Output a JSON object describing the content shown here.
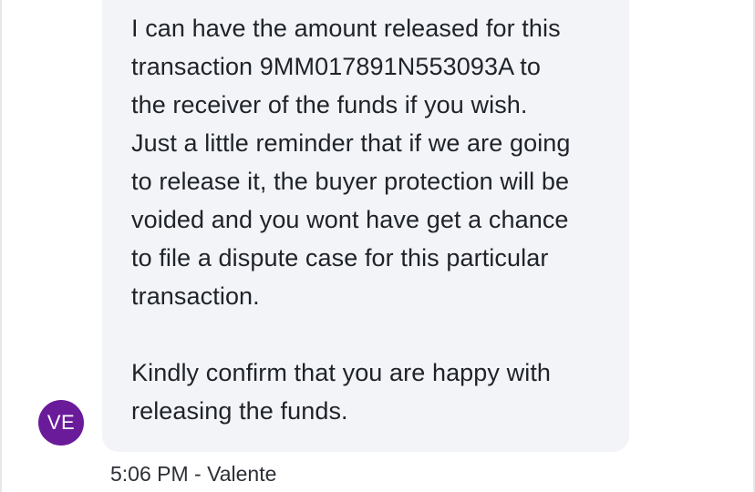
{
  "message": {
    "line_1": "I can have the amount released for this",
    "line_2": "transaction 9MM017891N553093A to",
    "line_3": "the receiver of the funds if you wish.",
    "line_4": "Just a little reminder that if we are going",
    "line_5": "to release it, the buyer protection will be",
    "line_6": "voided and you wont have get a chance",
    "line_7": "to file a dispute case for this particular",
    "line_8": "transaction.",
    "line_9": "Kindly confirm that you are happy with",
    "line_10": "releasing the funds."
  },
  "sender": {
    "initials": "VE",
    "meta": "5:06 PM - Valente"
  },
  "colors": {
    "bubble": "#f2f4f8",
    "avatar": "#6a1b9a",
    "text": "#1f2329"
  }
}
